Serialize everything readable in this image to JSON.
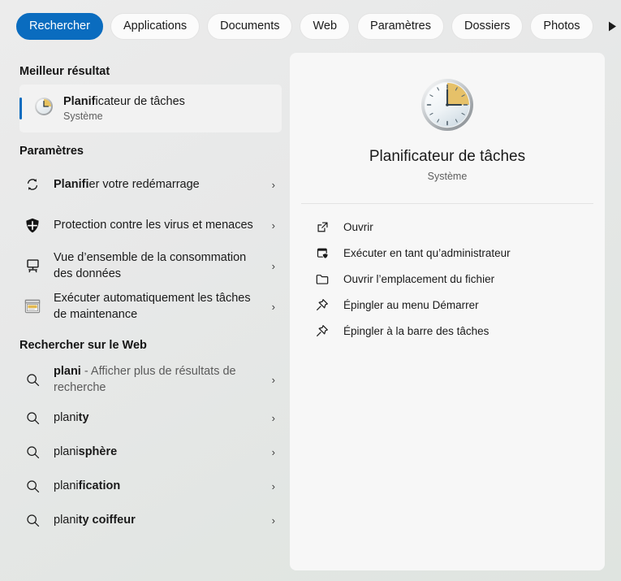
{
  "header": {
    "tabs": [
      {
        "label": "Rechercher",
        "active": true
      },
      {
        "label": "Applications",
        "active": false
      },
      {
        "label": "Documents",
        "active": false
      },
      {
        "label": "Web",
        "active": false
      },
      {
        "label": "Paramètres",
        "active": false
      },
      {
        "label": "Dossiers",
        "active": false
      },
      {
        "label": "Photos",
        "active": false
      }
    ],
    "scroll_forward_icon": "play-triangle-icon",
    "overflow_label": "···"
  },
  "accent_color": "#0a6cbf",
  "left_pane": {
    "best_result": {
      "section_title": "Meilleur résultat",
      "icon": "task-scheduler-clock-icon",
      "title_bold": "Planif",
      "title_rest": "icateur de tâches",
      "subtitle": "Système"
    },
    "settings": {
      "section_title": "Paramètres",
      "items": [
        {
          "icon": "refresh-icon",
          "bold": "Planifi",
          "rest": "er votre redémarrage",
          "chevron": "›"
        },
        {
          "icon": "shield-icon",
          "bold": "",
          "rest": "Protection contre les virus et menaces",
          "chevron": "›"
        },
        {
          "icon": "data-usage-monitor-icon",
          "bold": "",
          "rest": "Vue d’ensemble de la consommation des données",
          "chevron": "›"
        },
        {
          "icon": "maintenance-window-icon",
          "bold": "",
          "rest": "Exécuter automatiquement les tâches de maintenance",
          "chevron": "›"
        }
      ]
    },
    "web_search": {
      "section_title": "Rechercher sur le Web",
      "items": [
        {
          "icon": "search-icon",
          "bold": "plani",
          "rest": " - Afficher plus de résultats de recherche",
          "dim": true,
          "chevron": "›"
        },
        {
          "icon": "search-icon",
          "bold": "plani",
          "rest": "ty",
          "dim": false,
          "chevron": "›"
        },
        {
          "icon": "search-icon",
          "bold": "plani",
          "rest": "sphère",
          "dim": false,
          "chevron": "›"
        },
        {
          "icon": "search-icon",
          "bold": "plani",
          "rest": "fication",
          "dim": false,
          "chevron": "›"
        },
        {
          "icon": "search-icon",
          "bold": "plani",
          "rest": "ty coiffeur",
          "dim": false,
          "chevron": "›"
        }
      ]
    }
  },
  "preview": {
    "icon": "task-scheduler-clock-icon",
    "title": "Planificateur de tâches",
    "subtitle": "Système",
    "actions": [
      {
        "icon": "open-external-icon",
        "label": "Ouvrir"
      },
      {
        "icon": "run-as-admin-icon",
        "label": "Exécuter en tant qu’administrateur"
      },
      {
        "icon": "folder-icon",
        "label": "Ouvrir l’emplacement du fichier"
      },
      {
        "icon": "pin-icon",
        "label": "Épingler au menu Démarrer"
      },
      {
        "icon": "pin-icon",
        "label": "Épingler à la barre des tâches"
      }
    ]
  }
}
